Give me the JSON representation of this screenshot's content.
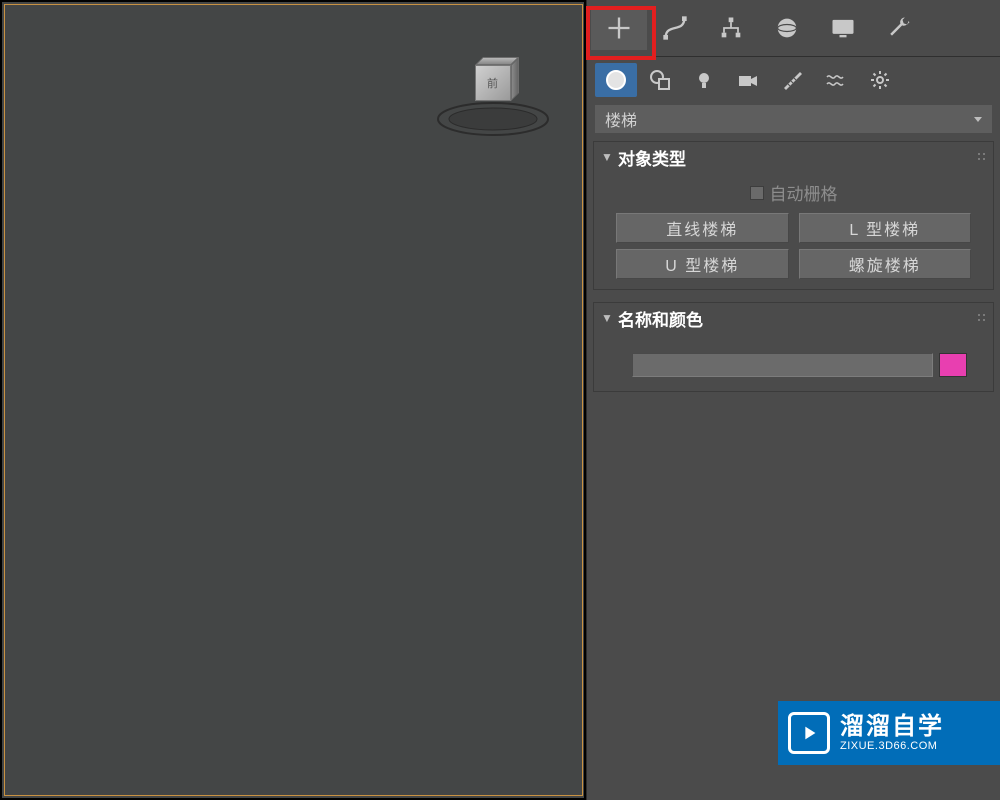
{
  "viewport": {
    "gizmo_label": "前"
  },
  "highlight": {
    "target": "create-tab"
  },
  "tabs": [
    {
      "name": "create-tab",
      "icon": "plus-icon",
      "active": true
    },
    {
      "name": "modify-tab",
      "icon": "curve-icon"
    },
    {
      "name": "hierarchy-tab",
      "icon": "hierarchy-icon"
    },
    {
      "name": "motion-tab",
      "icon": "sphere-icon"
    },
    {
      "name": "display-tab",
      "icon": "display-icon"
    },
    {
      "name": "utilities-tab",
      "icon": "wrench-icon"
    }
  ],
  "subtabs": [
    {
      "name": "geometry-icon",
      "icon": "circle-filled-icon",
      "selected": true
    },
    {
      "name": "shapes-icon",
      "icon": "shapes-icon"
    },
    {
      "name": "lights-icon",
      "icon": "light-icon"
    },
    {
      "name": "cameras-icon",
      "icon": "camera-icon"
    },
    {
      "name": "helpers-icon",
      "icon": "measure-icon"
    },
    {
      "name": "spacewarps-icon",
      "icon": "waves-icon"
    },
    {
      "name": "systems-icon",
      "icon": "gear-icon"
    }
  ],
  "dropdown": {
    "label": "楼梯"
  },
  "rollout_object_type": {
    "title": "对象类型",
    "auto_grid": "自动栅格",
    "buttons": [
      "直线楼梯",
      "L 型楼梯",
      "U 型楼梯",
      "螺旋楼梯"
    ]
  },
  "rollout_name_color": {
    "title": "名称和颜色",
    "name_value": "",
    "color": "#e83fb0"
  },
  "watermark": {
    "zh": "溜溜自学",
    "en": "ZIXUE.3D66.COM"
  }
}
